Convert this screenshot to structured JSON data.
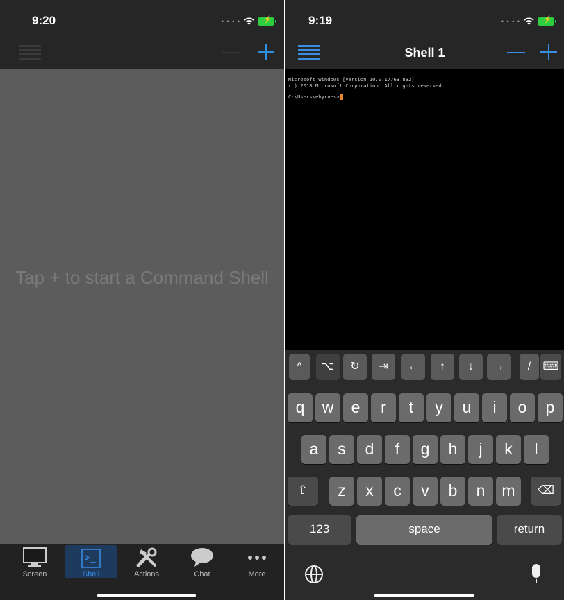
{
  "left": {
    "status_time": "9:20",
    "empty_message": "Tap + to start a Command Shell",
    "tabs": [
      {
        "label": "Screen",
        "icon": "monitor-icon"
      },
      {
        "label": "Shell",
        "icon": "terminal-icon"
      },
      {
        "label": "Actions",
        "icon": "tools-icon"
      },
      {
        "label": "Chat",
        "icon": "chat-bubble-icon"
      },
      {
        "label": "More",
        "icon": "more-dots-icon"
      }
    ],
    "active_tab": "Shell"
  },
  "right": {
    "status_time": "9:19",
    "nav_title": "Shell 1",
    "terminal_lines": [
      "Microsoft Windows [Version 10.0.17763.832]",
      "(c) 2018 Microsoft Corporation. All rights reserved.",
      "",
      "C:\\Users\\ebyrnes>"
    ],
    "accessory_keys": [
      "^",
      "⌥",
      "↻",
      "⇥",
      "←",
      "↑",
      "↓",
      "→",
      "/",
      "⌨"
    ],
    "keyboard_rows": [
      [
        "q",
        "w",
        "e",
        "r",
        "t",
        "y",
        "u",
        "i",
        "o",
        "p"
      ],
      [
        "a",
        "s",
        "d",
        "f",
        "g",
        "h",
        "j",
        "k",
        "l"
      ],
      [
        "⇧",
        "z",
        "x",
        "c",
        "v",
        "b",
        "n",
        "m",
        "⌫"
      ]
    ],
    "key_123": "123",
    "key_space": "space",
    "key_return": "return"
  },
  "colors": {
    "accent": "#3a8ee6",
    "cursor": "#e8842c",
    "battery": "#2ecc40"
  }
}
